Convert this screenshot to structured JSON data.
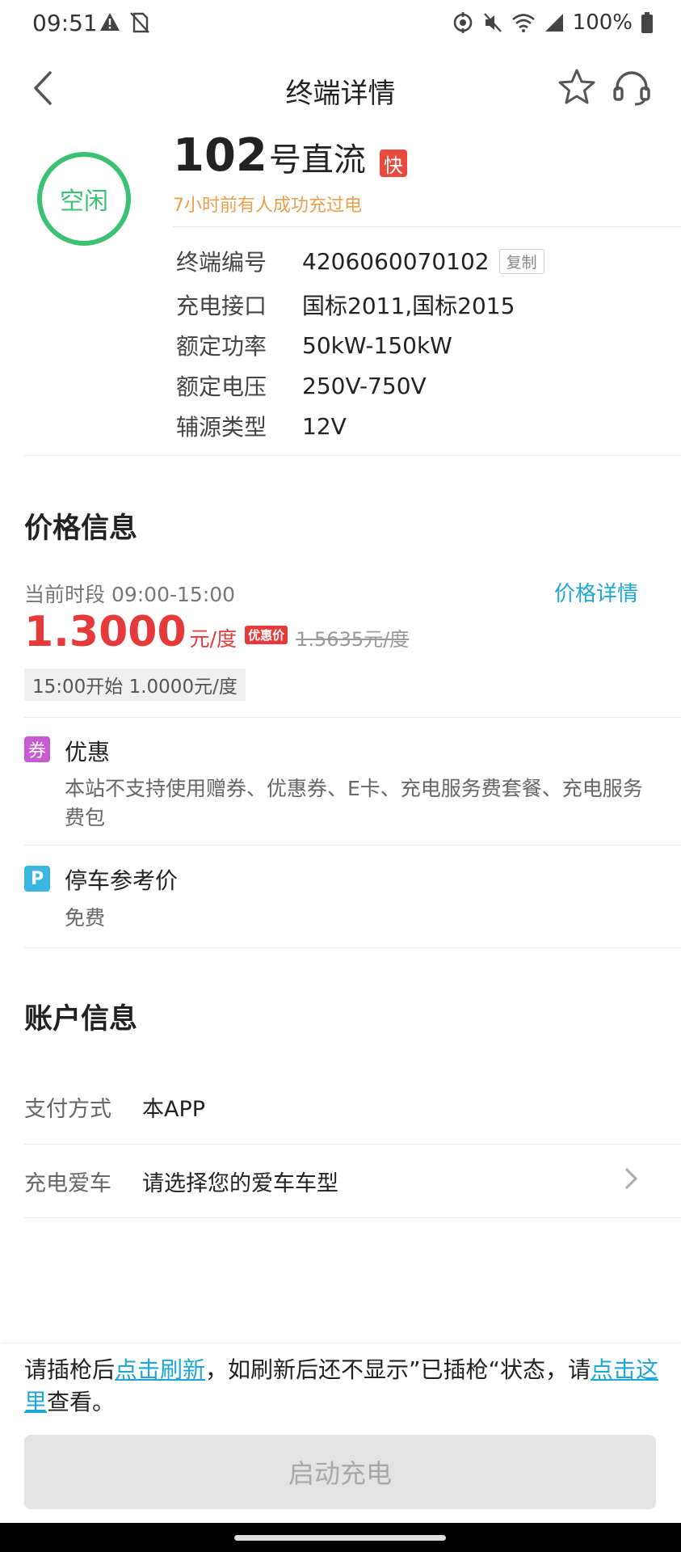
{
  "status_bar": {
    "time": "09:51",
    "battery": "100%"
  },
  "nav": {
    "title": "终端详情"
  },
  "terminal": {
    "status": "空闲",
    "number": "102",
    "type": "号直流",
    "speed_badge": "快",
    "last_charge": "7小时前有人成功充过电",
    "specs": [
      {
        "label": "终端编号",
        "value": "4206060070102"
      },
      {
        "label": "充电接口",
        "value": "国标2011,国标2015"
      },
      {
        "label": "额定功率",
        "value": "50kW-150kW"
      },
      {
        "label": "额定电压",
        "value": "250V-750V"
      },
      {
        "label": "辅源类型",
        "value": "12V"
      }
    ],
    "copy_label": "复制"
  },
  "price": {
    "section_title": "价格信息",
    "period": "当前时段 09:00-15:00",
    "detail_link": "价格详情",
    "current": "1.3000",
    "unit": "元/度",
    "promo_tag": "优惠价",
    "original": "1.5635元/度",
    "next": "15:00开始  1.0000元/度"
  },
  "discount": {
    "icon_char": "券",
    "title": "优惠",
    "desc": "本站不支持使用赠券、优惠券、E卡、充电服务费套餐、充电服务费包"
  },
  "parking": {
    "icon_char": "P",
    "title": "停车参考价",
    "desc": "免费"
  },
  "account": {
    "section_title": "账户信息",
    "pay_label": "支付方式",
    "pay_value": "本APP",
    "car_label": "充电爱车",
    "car_value": "请选择您的爱车车型"
  },
  "bottom": {
    "notice_1": "请插枪后",
    "link_refresh": "点击刷新",
    "notice_2": "，如刷新后还不显示”已插枪“状态，请",
    "link_here": "点击这里",
    "notice_3": "查看。",
    "start_button": "启动充电"
  },
  "colors": {
    "accent_green": "#3cc173",
    "price_red": "#e63a3a",
    "link_blue": "#1ea7d6",
    "orange": "#e8a04a"
  }
}
